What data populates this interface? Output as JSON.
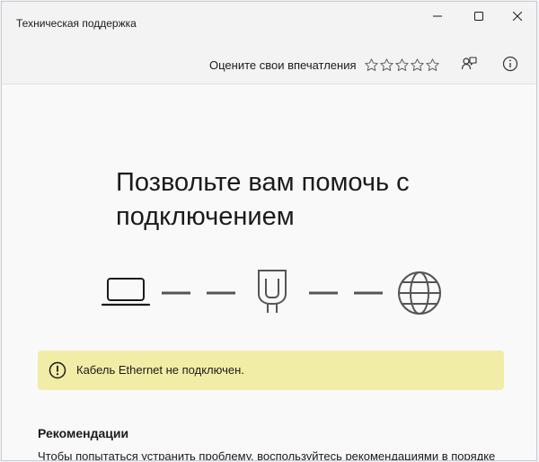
{
  "window": {
    "title": "Техническая поддержка",
    "controls": {
      "minimize": "minimize-icon",
      "maximize": "maximize-icon",
      "close": "close-icon"
    }
  },
  "toolbar": {
    "rate_label": "Оцените свои впечатления",
    "stars": 5,
    "feedback_icon": "feedback-icon",
    "info_icon": "info-icon"
  },
  "main": {
    "headline": "Позвольте вам помочь с подключением",
    "diagram": [
      "laptop-icon",
      "router-icon",
      "globe-icon"
    ],
    "warning": {
      "icon": "warning-icon",
      "text": "Кабель Ethernet не подключен.",
      "color": "#f2eda6"
    },
    "recommendations": {
      "title": "Рекомендации",
      "text": "Чтобы попытаться устранить проблему, воспользуйтесь рекомендациями в порядке"
    }
  }
}
